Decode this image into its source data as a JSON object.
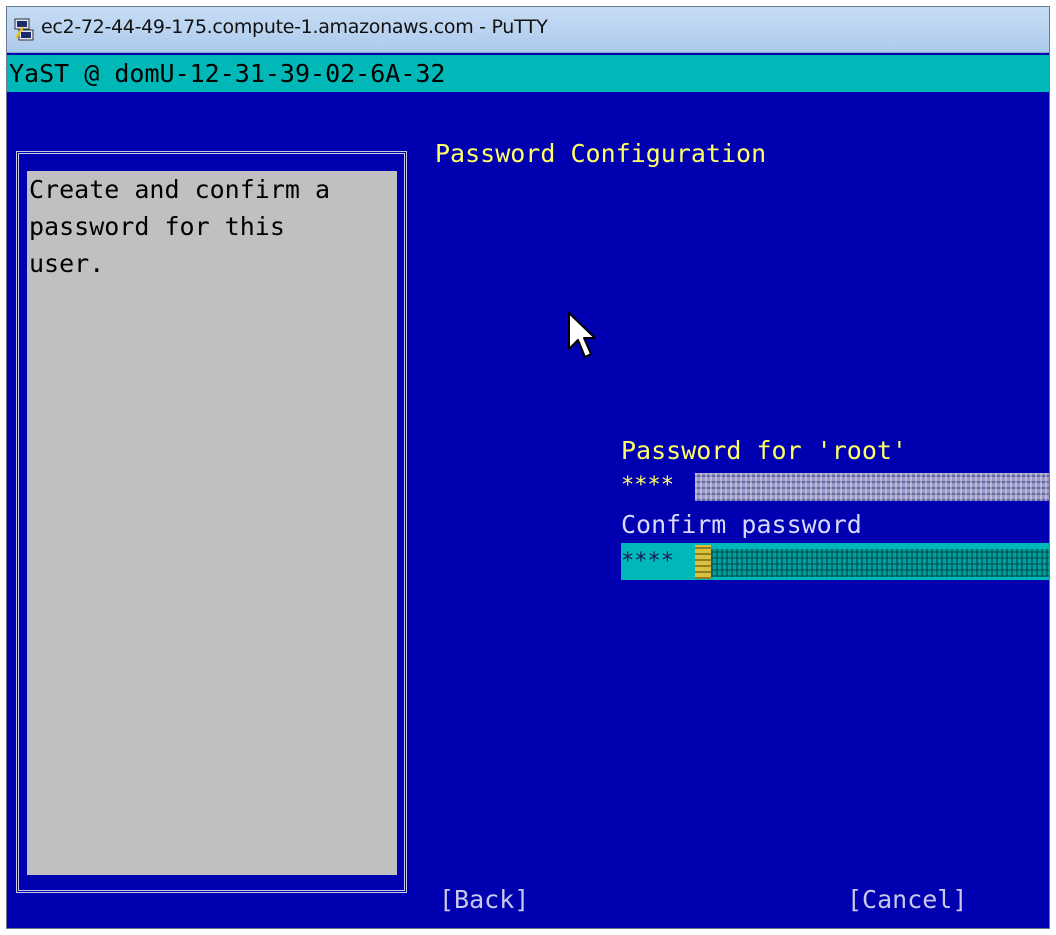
{
  "window": {
    "title": "ec2-72-44-49-175.compute-1.amazonaws.com - PuTTY",
    "icon": "putty-icon"
  },
  "terminal": {
    "yast_header": "YaST @ domU-12-31-39-02-6A-32",
    "help": {
      "lines": [
        "Create and confirm a",
        "password for this",
        "user."
      ]
    },
    "dialog_title": "Password Configuration",
    "password_field": {
      "label": "Password for 'root'",
      "value": "****"
    },
    "confirm_field": {
      "label": "Confirm password",
      "value": "****"
    },
    "buttons": {
      "back": "[Back]",
      "cancel": "[Cancel]"
    }
  },
  "colors": {
    "background": "#0000b0",
    "header": "#00b8b8",
    "help_panel": "#c0c0c0",
    "label_highlight": "#ffff66"
  }
}
